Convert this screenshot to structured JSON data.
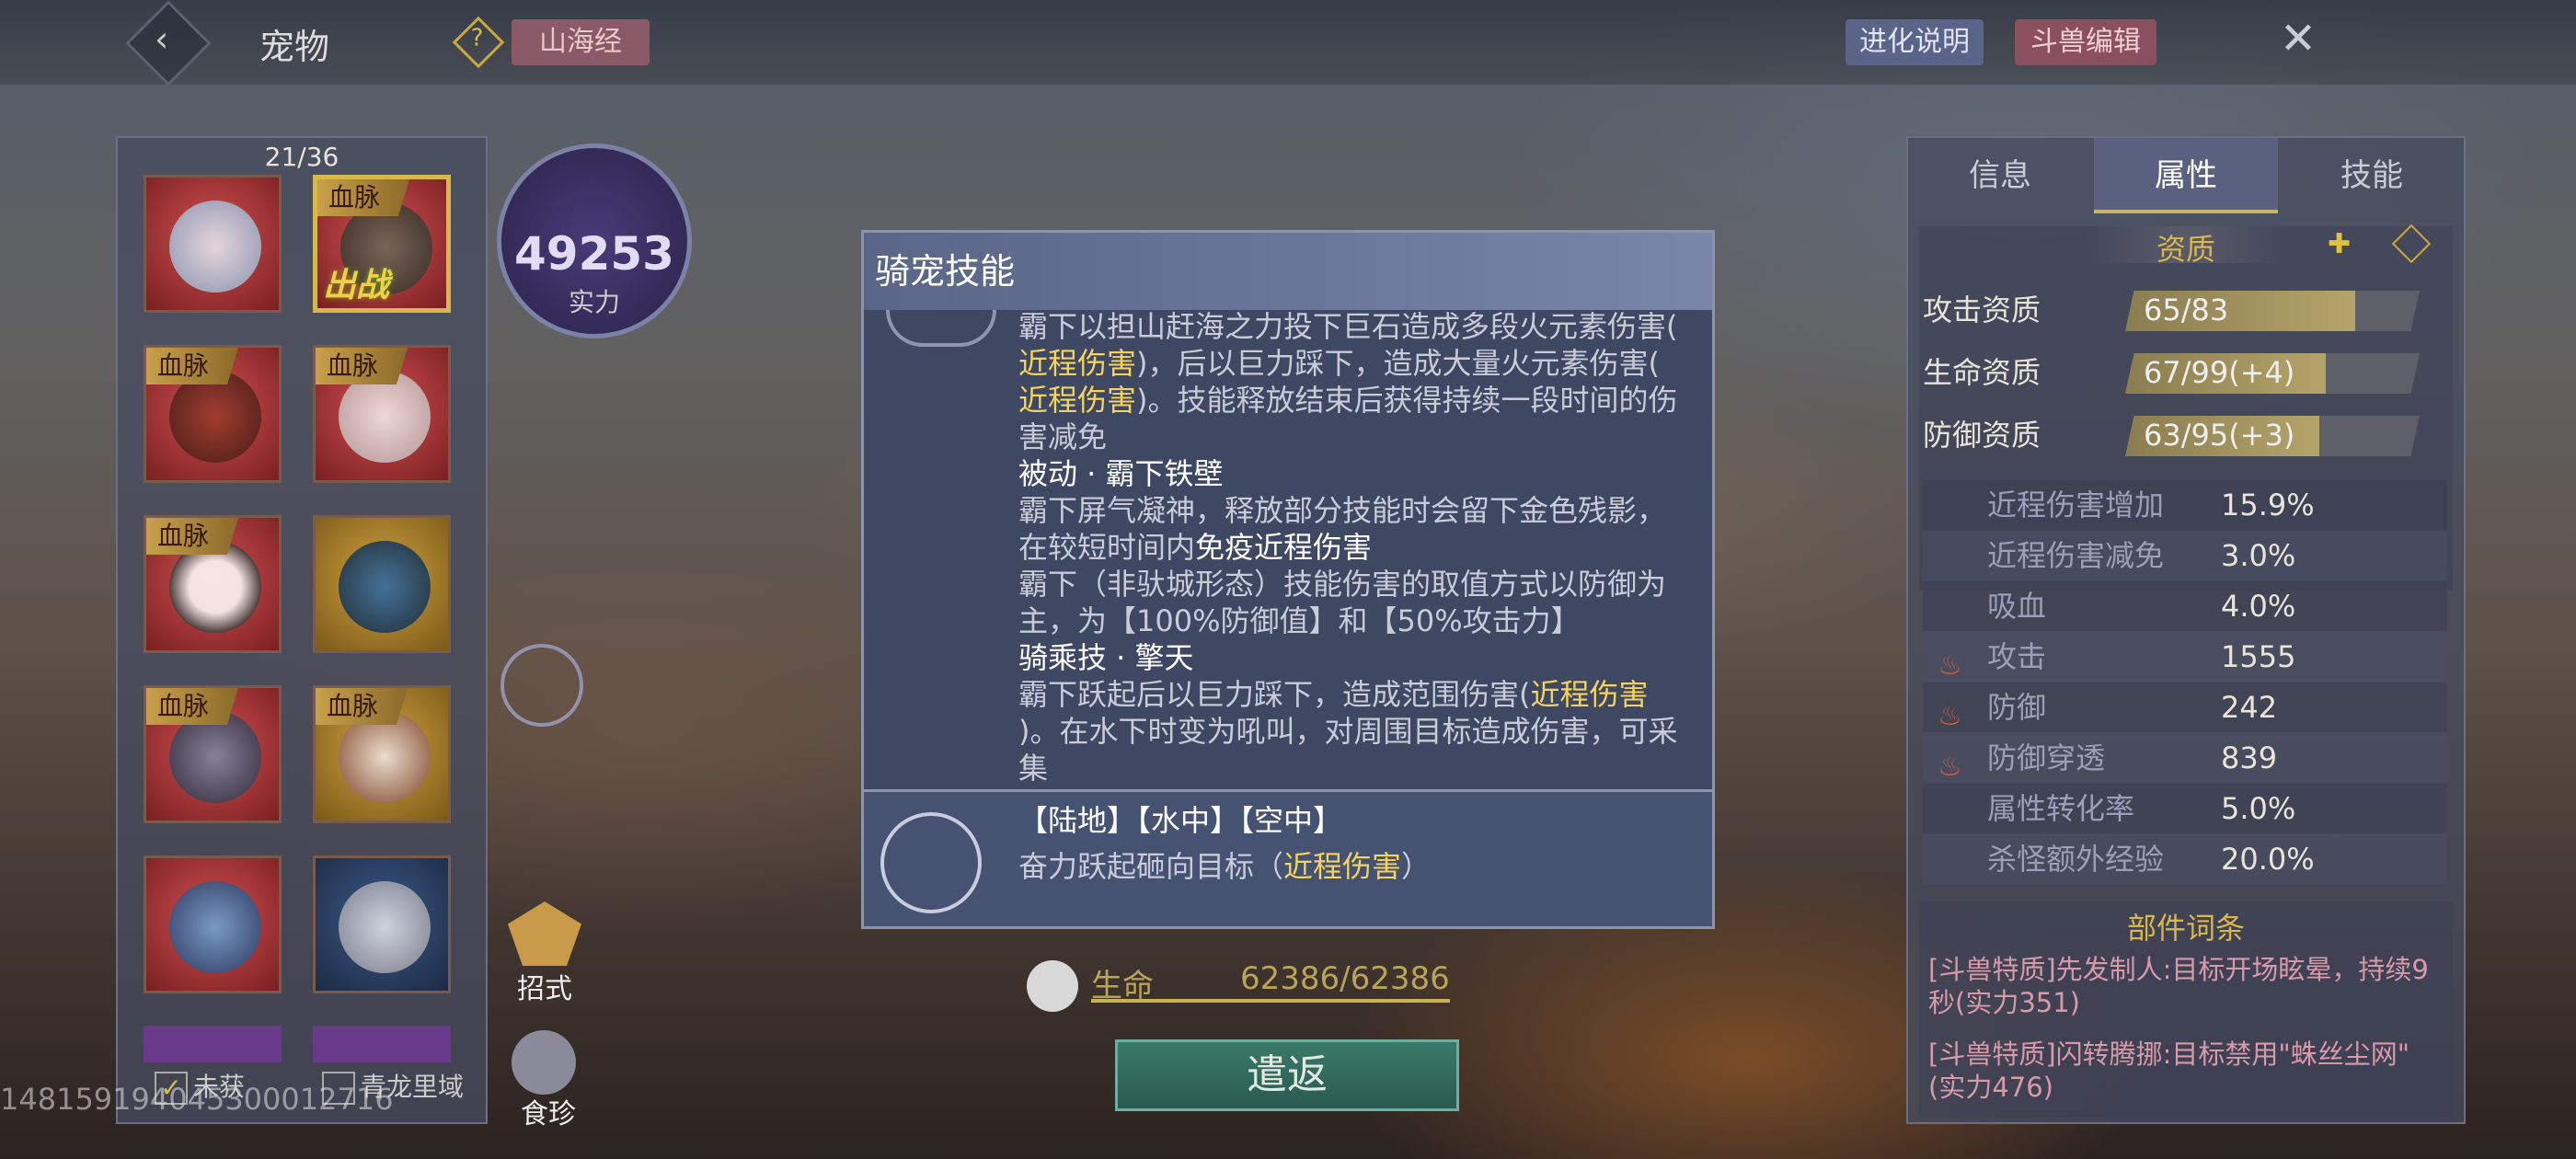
{
  "header": {
    "back_icon": "‹",
    "title": "宠物",
    "help_icon": "?",
    "btn_shanhaijing": "山海经",
    "btn_evolution": "进化说明",
    "btn_beast_edit": "斗兽编辑",
    "close_icon": "✕"
  },
  "pet_list": {
    "count": "21/36",
    "bloodline_label": "血脉",
    "deployed_label": "出战",
    "filter_owned": "未获",
    "filter_region": "青龙里域"
  },
  "power": {
    "value": "49253",
    "label": "实力"
  },
  "side": {
    "moves_label": "招式",
    "food_label": "食珍"
  },
  "hp": {
    "label": "生命",
    "value": "62386/62386"
  },
  "release_button": "遣返",
  "modal": {
    "title": "骑宠技能",
    "p1a": "霸下以担山赶海之力投下巨石造成多段火元素伤害(",
    "p1b": "近程伤害",
    "p1c": ")，后以巨力踩下，造成大量火元素伤害(",
    "p1d": "近程伤害",
    "p1e": ")。技能释放结束后获得持续一段时间的伤",
    "p1f": "害减免",
    "h2": "被动 · 霸下铁壁",
    "p2a": "霸下屏气凝神，释放部分技能时会留下金色残影，",
    "p2b": "在较短时间内",
    "p2c": "免疫近程伤害",
    "p3a": "霸下（非驮城形态）技能伤害的取值方式以防御为",
    "p3b": "主，为【100%防御值】和【50%攻击力】",
    "h3": "骑乘技 · 擎天",
    "p4a": "霸下跃起后以巨力踩下，造成范围伤害(",
    "p4b": "近程伤害",
    "p4c": ")。在水下时变为吼叫，对周围目标造成伤害，可采",
    "p4d": "集",
    "terrain": "【陆地】【水中】【空中】",
    "s2a": "奋力跃起砸向目标（",
    "s2b": "近程伤害",
    "s2c": "）"
  },
  "right_panel": {
    "tabs": [
      "信息",
      "属性",
      "技能"
    ],
    "aptitude_title": "资质",
    "aptitudes": [
      {
        "label": "攻击资质",
        "value": "65/83",
        "fill": 0.78
      },
      {
        "label": "生命资质",
        "value": "67/99(+4)",
        "fill": 0.68
      },
      {
        "label": "防御资质",
        "value": "63/95(+3)",
        "fill": 0.66
      }
    ],
    "attrs": [
      {
        "label": "近程伤害增加",
        "value": "15.9%"
      },
      {
        "label": "近程伤害减免",
        "value": "3.0%"
      },
      {
        "label": "吸血",
        "value": "4.0%"
      },
      {
        "label": "攻击",
        "value": "1555"
      },
      {
        "label": "防御",
        "value": "242"
      },
      {
        "label": "防御穿透",
        "value": "839"
      },
      {
        "label": "属性转化率",
        "value": "5.0%"
      },
      {
        "label": "杀怪额外经验",
        "value": "20.0%"
      }
    ],
    "parts_title": "部件词条",
    "parts": [
      "[斗兽特质]先发制人:目标开场眩晕，持续9秒(实力351)",
      "[斗兽特质]闪转腾挪:目标禁用\"蛛丝尘网\"(实力476)"
    ]
  },
  "uid": "14815919404530001271​6"
}
